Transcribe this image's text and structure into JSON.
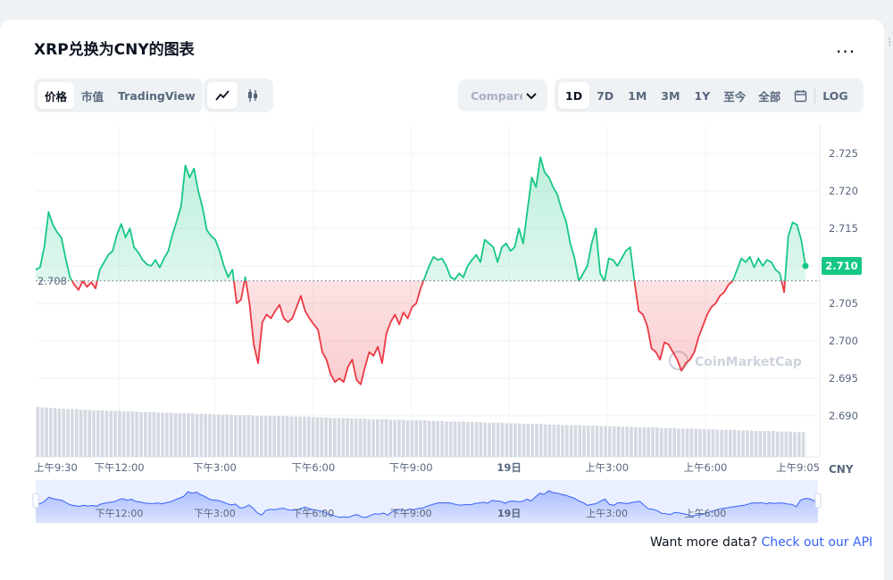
{
  "title": "XRP兑换为CNY的图表",
  "more_label": "...",
  "view_tabs": [
    {
      "label": "价格",
      "active": true
    },
    {
      "label": "市值",
      "active": false
    },
    {
      "label": "TradingView",
      "active": false
    }
  ],
  "chart_type_icons": [
    "line-chart-icon",
    "candlestick-icon"
  ],
  "compare_label": "Compare with",
  "range_tabs": [
    {
      "label": "1D",
      "active": true
    },
    {
      "label": "7D",
      "active": false
    },
    {
      "label": "1M",
      "active": false
    },
    {
      "label": "3M",
      "active": false
    },
    {
      "label": "1Y",
      "active": false
    },
    {
      "label": "至今",
      "active": false
    },
    {
      "label": "全部",
      "active": false
    }
  ],
  "log_label": "LOG",
  "footer": {
    "text": "Want more data? ",
    "link": "Check out our API"
  },
  "watermark": "CoinMarketCap",
  "colors": {
    "up": "#16c784",
    "down": "#ea3943",
    "brush": "#3861fb",
    "accent_badge": "#16c784"
  },
  "chart_data": {
    "type": "line",
    "series": [
      {
        "values": [
          2.7095,
          2.7098,
          2.7125,
          2.7172,
          2.7155,
          2.7145,
          2.7138,
          2.711,
          2.7085,
          2.7075,
          2.7068,
          2.708,
          2.7072,
          2.7078,
          2.707,
          2.7095,
          2.7105,
          2.7115,
          2.712,
          2.7142,
          2.7156,
          2.7138,
          2.715,
          2.7125,
          2.7118,
          2.7108,
          2.7102,
          2.71,
          2.7108,
          2.7098,
          2.711,
          2.712,
          2.7142,
          2.716,
          2.718,
          2.7234,
          2.7218,
          2.723,
          2.72,
          2.7178,
          2.7148,
          2.714,
          2.7135,
          2.712,
          2.71,
          2.7085,
          2.7095,
          2.705,
          2.7055,
          2.7085,
          2.705,
          2.6995,
          2.697,
          2.7025,
          2.7035,
          2.703,
          2.704,
          2.7048,
          2.703,
          2.7025,
          2.703,
          2.7045,
          2.706,
          2.704,
          2.703,
          2.7022,
          2.7015,
          2.6985,
          2.6975,
          2.6955,
          2.6945,
          2.695,
          2.6945,
          2.6965,
          2.6975,
          2.6948,
          2.6942,
          2.6965,
          2.6985,
          2.698,
          2.6992,
          2.697,
          2.701,
          2.7025,
          2.7035,
          2.7022,
          2.7038,
          2.703,
          2.7045,
          2.705,
          2.707,
          2.7085,
          2.71,
          2.7112,
          2.7108,
          2.711,
          2.71,
          2.7085,
          2.7082,
          2.709,
          2.7085,
          2.71,
          2.7108,
          2.7115,
          2.7105,
          2.7135,
          2.713,
          2.7125,
          2.7105,
          2.7125,
          2.713,
          2.712,
          2.7125,
          2.715,
          2.713,
          2.7175,
          2.7218,
          2.7205,
          2.7245,
          2.7225,
          2.7218,
          2.7205,
          2.7195,
          2.7175,
          2.716,
          2.713,
          2.711,
          2.708,
          2.709,
          2.71,
          2.713,
          2.715,
          2.709,
          2.708,
          2.711,
          2.7108,
          2.71,
          2.711,
          2.712,
          2.7125,
          2.708,
          2.704,
          2.7035,
          2.702,
          2.699,
          2.6985,
          2.6975,
          2.6998,
          2.6995,
          2.6985,
          2.6975,
          2.696,
          2.697,
          2.6975,
          2.6985,
          2.7005,
          2.702,
          2.7035,
          2.7045,
          2.705,
          2.706,
          2.7065,
          2.7075,
          2.708,
          2.7095,
          2.711,
          2.7105,
          2.7112,
          2.7098,
          2.711,
          2.71,
          2.7108,
          2.7105,
          2.7095,
          2.709,
          2.7065,
          2.714,
          2.7158,
          2.7155,
          2.7135,
          2.71
        ]
      }
    ],
    "baseline": 2.708,
    "last_value": 2.71,
    "ylim": [
      2.686,
      2.727
    ],
    "y_ticks": [
      2.725,
      2.72,
      2.715,
      2.71,
      2.705,
      2.7,
      2.695,
      2.69
    ],
    "y_tick_labels": [
      "2.725",
      "2.720",
      "2.715",
      "2.710",
      "2.705",
      "2.700",
      "2.695",
      "2.690"
    ],
    "baseline_label": "2.708",
    "last_label": "2.710",
    "currency_label": "CNY",
    "x_ticks": [
      {
        "pos": 0.0,
        "label": "上午9:30",
        "bold": false
      },
      {
        "pos": 0.1085,
        "label": "下午12:00",
        "bold": false
      },
      {
        "pos": 0.2325,
        "label": "下午3:00",
        "bold": false
      },
      {
        "pos": 0.3605,
        "label": "下午6:00",
        "bold": false
      },
      {
        "pos": 0.4875,
        "label": "下午9:00",
        "bold": false
      },
      {
        "pos": 0.615,
        "label": "19日",
        "bold": true
      },
      {
        "pos": 0.742,
        "label": "上午3:00",
        "bold": false
      },
      {
        "pos": 0.87,
        "label": "上午6:00",
        "bold": false
      },
      {
        "pos": 0.9975,
        "label": "上午9:05",
        "bold": false
      }
    ],
    "brush_ticks": [
      {
        "pos": 0.1085,
        "label": "下午12:00",
        "bold": false
      },
      {
        "pos": 0.2325,
        "label": "下午3:00",
        "bold": false
      },
      {
        "pos": 0.3605,
        "label": "下午6:00",
        "bold": false
      },
      {
        "pos": 0.4875,
        "label": "下午9:00",
        "bold": false
      },
      {
        "pos": 0.615,
        "label": "19日",
        "bold": true
      },
      {
        "pos": 0.742,
        "label": "上午3:00",
        "bold": false
      },
      {
        "pos": 0.87,
        "label": "上午6:00",
        "bold": false
      }
    ],
    "volume": [
      0.85,
      0.84,
      0.84,
      0.83,
      0.83,
      0.82,
      0.82,
      0.81,
      0.81,
      0.81,
      0.8,
      0.8,
      0.8,
      0.79,
      0.79,
      0.79,
      0.78,
      0.78,
      0.78,
      0.78,
      0.77,
      0.77,
      0.77,
      0.77,
      0.76,
      0.76,
      0.76,
      0.76,
      0.75,
      0.75,
      0.75,
      0.75,
      0.74,
      0.74,
      0.74,
      0.74,
      0.74,
      0.73,
      0.73,
      0.73,
      0.73,
      0.72,
      0.72,
      0.72,
      0.72,
      0.72,
      0.71,
      0.71,
      0.71,
      0.71,
      0.7,
      0.7,
      0.7,
      0.7,
      0.7,
      0.69,
      0.69,
      0.69,
      0.69,
      0.68,
      0.68,
      0.68,
      0.68,
      0.68,
      0.67,
      0.67,
      0.67,
      0.67,
      0.66,
      0.66,
      0.66,
      0.66,
      0.66,
      0.65,
      0.65,
      0.65,
      0.65,
      0.64,
      0.64,
      0.64,
      0.64,
      0.64,
      0.63,
      0.63,
      0.63,
      0.63,
      0.62,
      0.62,
      0.62,
      0.62,
      0.62,
      0.61,
      0.61,
      0.61,
      0.61,
      0.6,
      0.6,
      0.6,
      0.6,
      0.6,
      0.59,
      0.59,
      0.59,
      0.59,
      0.58,
      0.58,
      0.58,
      0.58,
      0.58,
      0.57,
      0.57,
      0.57,
      0.57,
      0.56,
      0.56,
      0.56,
      0.56,
      0.56,
      0.55,
      0.55,
      0.55,
      0.55,
      0.54,
      0.54,
      0.54,
      0.54,
      0.54,
      0.53,
      0.53,
      0.53,
      0.53,
      0.52,
      0.52,
      0.52,
      0.52,
      0.52,
      0.51,
      0.51,
      0.51,
      0.51,
      0.5,
      0.5,
      0.5,
      0.5,
      0.5,
      0.49,
      0.49,
      0.49,
      0.49,
      0.48,
      0.48,
      0.48,
      0.48,
      0.48,
      0.47,
      0.47,
      0.47,
      0.47,
      0.46,
      0.46,
      0.46,
      0.46,
      0.46,
      0.45,
      0.45,
      0.45,
      0.45,
      0.44,
      0.44,
      0.44,
      0.44,
      0.44,
      0.43,
      0.43,
      0.43,
      0.43,
      0.42,
      0.42,
      0.42
    ]
  }
}
